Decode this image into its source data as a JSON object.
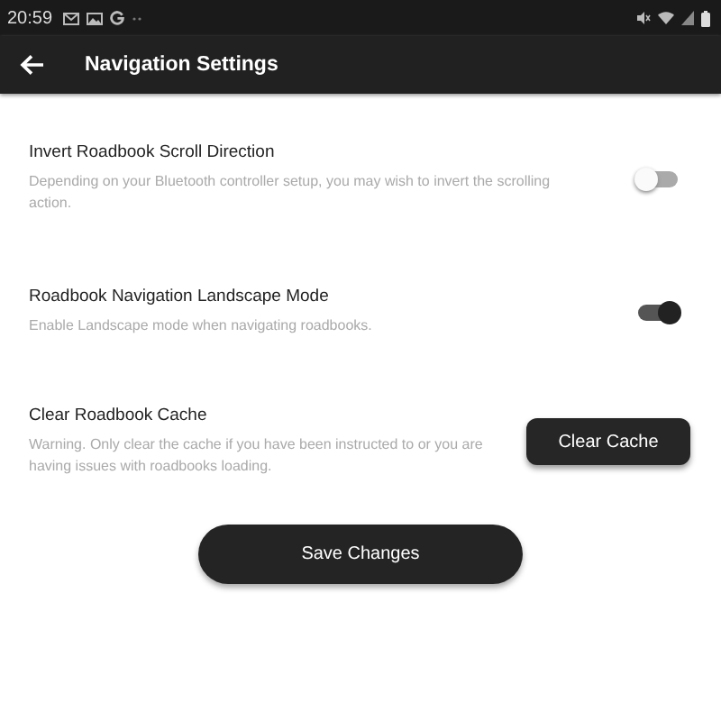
{
  "status_bar": {
    "time": "20:59"
  },
  "app_bar": {
    "title": "Navigation Settings"
  },
  "settings": [
    {
      "kind": "toggle",
      "title": "Invert Roadbook Scroll Direction",
      "description": "Depending on your Bluetooth controller setup, you may wish to invert the scrolling action.",
      "on": false
    },
    {
      "kind": "toggle",
      "title": "Roadbook Navigation Landscape Mode",
      "description": "Enable Landscape mode when navigating roadbooks.",
      "on": true
    },
    {
      "kind": "button",
      "title": "Clear Roadbook Cache",
      "description": "Warning. Only clear the cache if you have been instructed to or you are having issues with roadbooks loading.",
      "button": "Clear Cache"
    }
  ],
  "save_button": "Save Changes"
}
